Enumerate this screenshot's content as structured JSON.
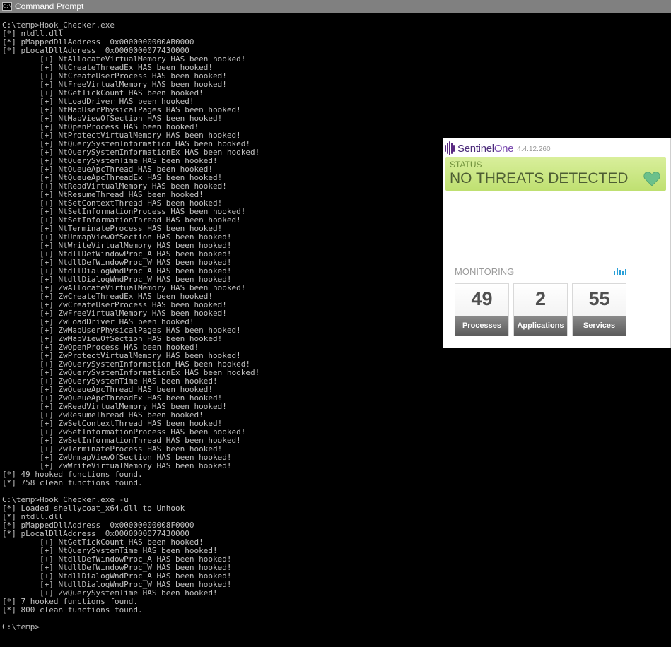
{
  "window": {
    "title": "Command Prompt",
    "icon": "cmd-icon"
  },
  "console": {
    "lines": [
      "C:\\temp>Hook_Checker.exe",
      "[*] ntdll.dll",
      "[*] pMappedDllAddress  0x0000000000AB0000",
      "[*] pLocalDllAddress  0x0000000077430000",
      "        [+] NtAllocateVirtualMemory HAS been hooked!",
      "        [+] NtCreateThreadEx HAS been hooked!",
      "        [+] NtCreateUserProcess HAS been hooked!",
      "        [+] NtFreeVirtualMemory HAS been hooked!",
      "        [+] NtGetTickCount HAS been hooked!",
      "        [+] NtLoadDriver HAS been hooked!",
      "        [+] NtMapUserPhysicalPages HAS been hooked!",
      "        [+] NtMapViewOfSection HAS been hooked!",
      "        [+] NtOpenProcess HAS been hooked!",
      "        [+] NtProtectVirtualMemory HAS been hooked!",
      "        [+] NtQuerySystemInformation HAS been hooked!",
      "        [+] NtQuerySystemInformationEx HAS been hooked!",
      "        [+] NtQuerySystemTime HAS been hooked!",
      "        [+] NtQueueApcThread HAS been hooked!",
      "        [+] NtQueueApcThreadEx HAS been hooked!",
      "        [+] NtReadVirtualMemory HAS been hooked!",
      "        [+] NtResumeThread HAS been hooked!",
      "        [+] NtSetContextThread HAS been hooked!",
      "        [+] NtSetInformationProcess HAS been hooked!",
      "        [+] NtSetInformationThread HAS been hooked!",
      "        [+] NtTerminateProcess HAS been hooked!",
      "        [+] NtUnmapViewOfSection HAS been hooked!",
      "        [+] NtWriteVirtualMemory HAS been hooked!",
      "        [+] NtdllDefWindowProc_A HAS been hooked!",
      "        [+] NtdllDefWindowProc_W HAS been hooked!",
      "        [+] NtdllDialogWndProc_A HAS been hooked!",
      "        [+] NtdllDialogWndProc_W HAS been hooked!",
      "        [+] ZwAllocateVirtualMemory HAS been hooked!",
      "        [+] ZwCreateThreadEx HAS been hooked!",
      "        [+] ZwCreateUserProcess HAS been hooked!",
      "        [+] ZwFreeVirtualMemory HAS been hooked!",
      "        [+] ZwLoadDriver HAS been hooked!",
      "        [+] ZwMapUserPhysicalPages HAS been hooked!",
      "        [+] ZwMapViewOfSection HAS been hooked!",
      "        [+] ZwOpenProcess HAS been hooked!",
      "        [+] ZwProtectVirtualMemory HAS been hooked!",
      "        [+] ZwQuerySystemInformation HAS been hooked!",
      "        [+] ZwQuerySystemInformationEx HAS been hooked!",
      "        [+] ZwQuerySystemTime HAS been hooked!",
      "        [+] ZwQueueApcThread HAS been hooked!",
      "        [+] ZwQueueApcThreadEx HAS been hooked!",
      "        [+] ZwReadVirtualMemory HAS been hooked!",
      "        [+] ZwResumeThread HAS been hooked!",
      "        [+] ZwSetContextThread HAS been hooked!",
      "        [+] ZwSetInformationProcess HAS been hooked!",
      "        [+] ZwSetInformationThread HAS been hooked!",
      "        [+] ZwTerminateProcess HAS been hooked!",
      "        [+] ZwUnmapViewOfSection HAS been hooked!",
      "        [+] ZwWriteVirtualMemory HAS been hooked!",
      "[*] 49 hooked functions found.",
      "[*] 758 clean functions found.",
      "",
      "C:\\temp>Hook_Checker.exe -u",
      "[*] Loaded shellycoat_x64.dll to Unhook",
      "[*] ntdll.dll",
      "[*] pMappedDllAddress  0x00000000008F0000",
      "[*] pLocalDllAddress  0x0000000077430000",
      "        [+] NtGetTickCount HAS been hooked!",
      "        [+] NtQuerySystemTime HAS been hooked!",
      "        [+] NtdllDefWindowProc_A HAS been hooked!",
      "        [+] NtdllDefWindowProc_W HAS been hooked!",
      "        [+] NtdllDialogWndProc_A HAS been hooked!",
      "        [+] NtdllDialogWndProc_W HAS been hooked!",
      "        [+] ZwQuerySystemTime HAS been hooked!",
      "[*] 7 hooked functions found.",
      "[*] 800 clean functions found.",
      "",
      "C:\\temp>"
    ]
  },
  "sentinel": {
    "brand_prefix": "Sentinel",
    "brand_suffix": "One",
    "version": "4.4.12.260",
    "status_label": "STATUS",
    "status_text": "NO THREATS DETECTED",
    "status_icon": "heart-icon",
    "monitoring_label": "MONITORING",
    "monitoring_icon": "signal-icon",
    "tiles": [
      {
        "value": "49",
        "label": "Processes"
      },
      {
        "value": "2",
        "label": "Applications"
      },
      {
        "value": "55",
        "label": "Services"
      }
    ],
    "colors": {
      "brand": "#4b2b7a",
      "status_bg": "#c9e685",
      "heart": "#6cc08b"
    }
  }
}
